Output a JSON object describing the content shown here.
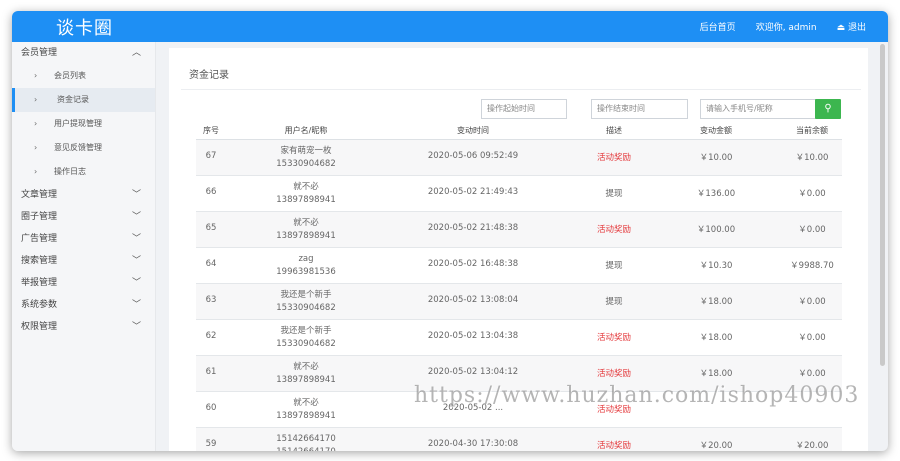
{
  "header": {
    "brand": "谈卡圈",
    "nav": {
      "home": "后台首页",
      "welcome": "欢迎你, admin",
      "logout": "退出"
    }
  },
  "sidebar": {
    "groups": [
      {
        "label": "会员管理",
        "expanded": true,
        "items": [
          "会员列表",
          "资金记录",
          "用户提现管理",
          "意见反馈管理",
          "操作日志"
        ]
      },
      {
        "label": "文章管理"
      },
      {
        "label": "圈子管理"
      },
      {
        "label": "广告管理"
      },
      {
        "label": "搜索管理"
      },
      {
        "label": "举报管理"
      },
      {
        "label": "系统参数"
      },
      {
        "label": "权限管理"
      }
    ],
    "active_item": "资金记录"
  },
  "page": {
    "title": "资金记录",
    "filters": {
      "start_placeholder": "操作起始时间",
      "end_placeholder": "操作结束时间",
      "phone_placeholder": "请输入手机号/昵称"
    }
  },
  "table": {
    "headers": [
      "序号",
      "用户名/昵称",
      "变动时间",
      "描述",
      "变动金额",
      "当前余额"
    ],
    "rows": [
      {
        "id": "67",
        "name": "家有萌宠一枚",
        "phone": "15330904682",
        "time": "2020-05-06 09:52:49",
        "desc": "活动奖励",
        "amount": "￥10.00",
        "balance": "￥10.00"
      },
      {
        "id": "66",
        "name": "就不必",
        "phone": "13897898941",
        "time": "2020-05-02 21:49:43",
        "desc": "提现",
        "amount": "￥136.00",
        "balance": "￥0.00"
      },
      {
        "id": "65",
        "name": "就不必",
        "phone": "13897898941",
        "time": "2020-05-02 21:48:38",
        "desc": "活动奖励",
        "amount": "￥100.00",
        "balance": "￥0.00"
      },
      {
        "id": "64",
        "name": "zag",
        "phone": "19963981536",
        "time": "2020-05-02 16:48:38",
        "desc": "提现",
        "amount": "￥10.30",
        "balance": "￥9988.70"
      },
      {
        "id": "63",
        "name": "我还是个新手",
        "phone": "15330904682",
        "time": "2020-05-02 13:08:04",
        "desc": "提现",
        "amount": "￥18.00",
        "balance": "￥0.00"
      },
      {
        "id": "62",
        "name": "我还是个新手",
        "phone": "15330904682",
        "time": "2020-05-02 13:04:38",
        "desc": "活动奖励",
        "amount": "￥18.00",
        "balance": "￥0.00"
      },
      {
        "id": "61",
        "name": "就不必",
        "phone": "13897898941",
        "time": "2020-05-02 13:04:12",
        "desc": "活动奖励",
        "amount": "￥18.00",
        "balance": "￥0.00"
      },
      {
        "id": "60",
        "name": "就不必",
        "phone": "13897898941",
        "time": "2020-05-02 ...",
        "desc": "活动奖励",
        "amount": "",
        "balance": ""
      },
      {
        "id": "59",
        "name": "15142664170",
        "phone": "15142664170",
        "time": "2020-04-30 17:30:08",
        "desc": "活动奖励",
        "amount": "￥20.00",
        "balance": "￥20.00"
      }
    ]
  },
  "watermark": "https://www.huzhan.com/ishop40903",
  "colors": {
    "accent": "#1e8ff4",
    "search_button": "#3cb64f",
    "reward_text": "#e4393c"
  }
}
